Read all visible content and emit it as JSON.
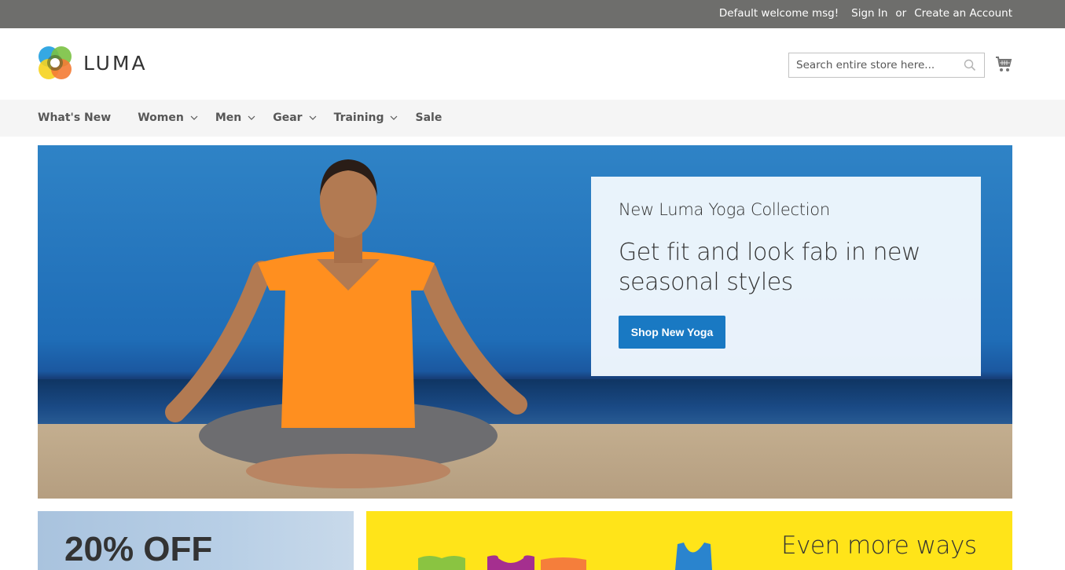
{
  "topbar": {
    "welcome": "Default welcome msg!",
    "sign_in": "Sign In",
    "or": "or",
    "create_account": "Create an Account"
  },
  "header": {
    "logo_text": "LUMA",
    "search_placeholder": "Search entire store here...",
    "search_icon": "search-icon",
    "cart_icon": "cart-icon"
  },
  "nav": {
    "items": [
      {
        "label": "What's New",
        "has_dropdown": false
      },
      {
        "label": "Women",
        "has_dropdown": true
      },
      {
        "label": "Men",
        "has_dropdown": true
      },
      {
        "label": "Gear",
        "has_dropdown": true
      },
      {
        "label": "Training",
        "has_dropdown": true
      },
      {
        "label": "Sale",
        "has_dropdown": false
      }
    ]
  },
  "hero": {
    "subtitle": "New Luma Yoga Collection",
    "headline": "Get fit and look fab in new seasonal styles",
    "button_label": "Shop New Yoga"
  },
  "tiles": {
    "left_text": "20% OFF",
    "right_text": "Even more ways"
  },
  "colors": {
    "topbar_bg": "#6e6e6c",
    "nav_bg": "#f5f5f5",
    "primary_button": "#1979c3",
    "yellow_tile": "#ffe419"
  }
}
